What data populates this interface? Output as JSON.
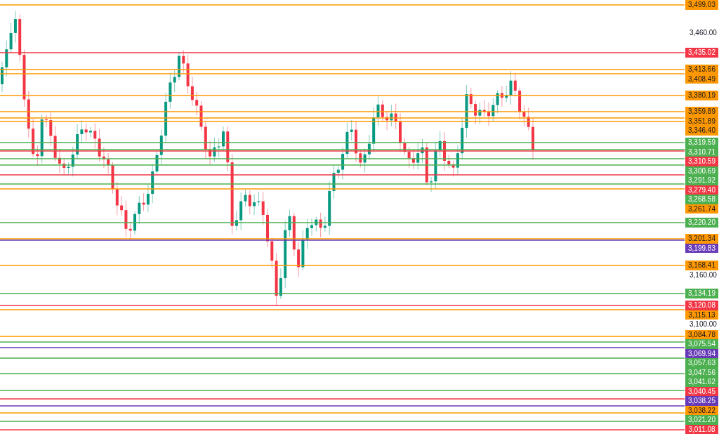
{
  "chart": {
    "axis_ticks": [
      {
        "label": "3,460.00"
      },
      {
        "label": "3,160.00"
      },
      {
        "label": "3,100.00"
      }
    ],
    "levels": [
      {
        "label": "3,499.03",
        "color": "#ff9800"
      },
      {
        "label": "3,435.02",
        "color": "#f23645"
      },
      {
        "label": "3,413.66",
        "color": "#ff9800"
      },
      {
        "label": "3,408.49",
        "color": "#ff9800"
      },
      {
        "label": "3,380.19",
        "color": "#ff9800"
      },
      {
        "label": "3,359.89",
        "color": "#ff9800"
      },
      {
        "label": "3,351.89",
        "color": "#ff9800"
      },
      {
        "label": "3,346.40",
        "color": "#ff9800"
      },
      {
        "label": "3,319.59",
        "color": "#4caf50"
      },
      {
        "label": "3,310.71",
        "color": "#4caf50"
      },
      {
        "label": "3,310.59",
        "color": "#f23645"
      },
      {
        "label": "3,300.69",
        "color": "#4caf50"
      },
      {
        "label": "3,291.92",
        "color": "#4caf50"
      },
      {
        "label": "3,279.40",
        "color": "#f23645"
      },
      {
        "label": "3,268.58",
        "color": "#4caf50"
      },
      {
        "label": "3,261.74",
        "color": "#ff9800"
      },
      {
        "label": "3,220.20",
        "color": "#4caf50"
      },
      {
        "label": "3,201.34",
        "color": "#ff9800"
      },
      {
        "label": "3,199.83",
        "color": "#673ab7"
      },
      {
        "label": "3,168.41",
        "color": "#ff9800"
      },
      {
        "label": "3,134.19",
        "color": "#4caf50"
      },
      {
        "label": "3,120.08",
        "color": "#f23645"
      },
      {
        "label": "3,115.13",
        "color": "#ff9800"
      },
      {
        "label": "3,084.78",
        "color": "#ff9800"
      },
      {
        "label": "3,075.54",
        "color": "#4caf50"
      },
      {
        "label": "3,069.94",
        "color": "#673ab7"
      },
      {
        "label": "3,057.63",
        "color": "#4caf50"
      },
      {
        "label": "3,047.56",
        "color": "#4caf50"
      },
      {
        "label": "3,041.62",
        "color": "#4caf50"
      },
      {
        "label": "3,040.45",
        "color": "#f23645"
      },
      {
        "label": "3,038.25",
        "color": "#673ab7"
      },
      {
        "label": "3,038.22",
        "color": "#ff9800"
      },
      {
        "label": "3,021.20",
        "color": "#4caf50"
      },
      {
        "label": "3,011.08",
        "color": "#f23645"
      }
    ]
  }
}
